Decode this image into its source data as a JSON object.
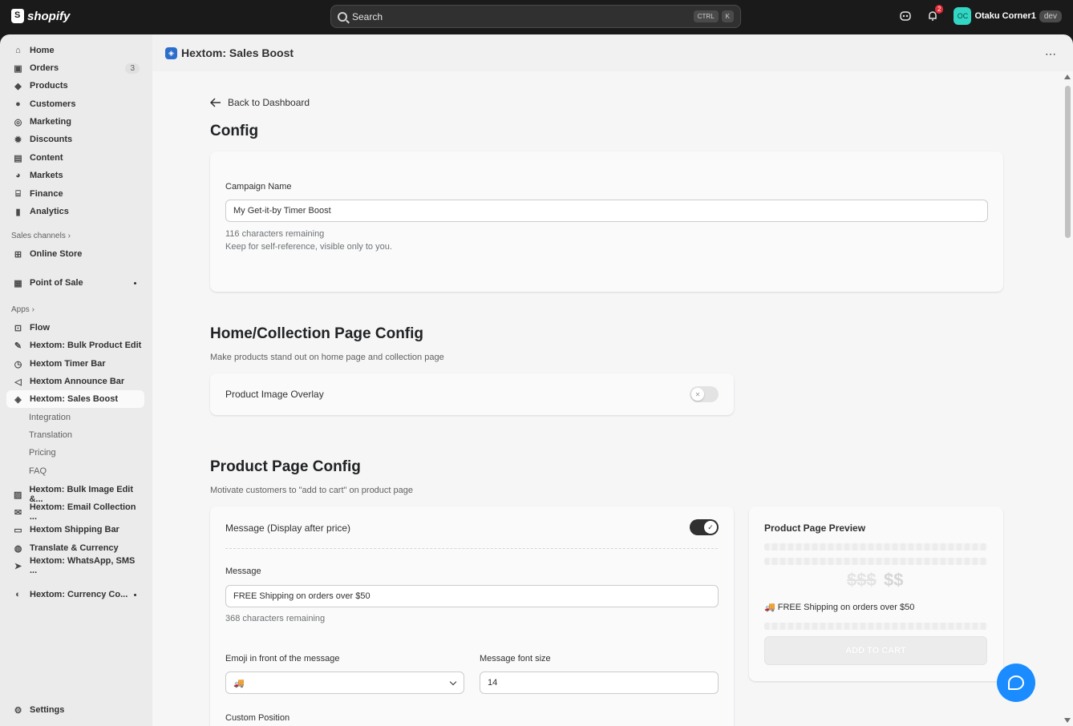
{
  "topbar": {
    "brand": "shopify",
    "search_placeholder": "Search",
    "kbd1": "CTRL",
    "kbd2": "K",
    "notification_count": "2",
    "avatar_initials": "OC",
    "store_name": "Otaku Corner1",
    "store_badge": "dev"
  },
  "sidebar": {
    "items": [
      {
        "label": "Home",
        "icon": "home-icon"
      },
      {
        "label": "Orders",
        "icon": "inbox-icon",
        "count": "3"
      },
      {
        "label": "Products",
        "icon": "tag-icon"
      },
      {
        "label": "Customers",
        "icon": "person-icon"
      },
      {
        "label": "Marketing",
        "icon": "target-icon"
      },
      {
        "label": "Discounts",
        "icon": "discount-icon"
      },
      {
        "label": "Content",
        "icon": "content-icon"
      },
      {
        "label": "Markets",
        "icon": "globe-icon"
      },
      {
        "label": "Finance",
        "icon": "bank-icon"
      },
      {
        "label": "Analytics",
        "icon": "chart-icon"
      }
    ],
    "sales_channels_label": "Sales channels",
    "online_store": "Online Store",
    "point_of_sale": "Point of Sale",
    "apps_label": "Apps",
    "apps": [
      "Flow",
      "Hextom: Bulk Product Edit",
      "Hextom Timer Bar",
      "Hextom Announce Bar",
      "Hextom: Sales Boost"
    ],
    "sub_items": [
      "Integration",
      "Translation",
      "Pricing",
      "FAQ"
    ],
    "more_apps": [
      "Hextom: Bulk Image Edit &...",
      "Hextom: Email Collection ...",
      "Hextom Shipping Bar",
      "Translate & Currency",
      "Hextom: WhatsApp, SMS ...",
      "Hextom: Currency Co..."
    ],
    "settings": "Settings"
  },
  "header": {
    "app_title": "Hextom: Sales Boost",
    "more": "⋯"
  },
  "page": {
    "back_label": "Back to Dashboard",
    "config_title": "Config",
    "campaign": {
      "label": "Campaign Name",
      "value": "My Get-it-by Timer Boost",
      "remaining": "116 characters remaining",
      "help": "Keep for self-reference, visible only to you."
    },
    "home_section": {
      "title": "Home/Collection Page Config",
      "subtitle": "Make products stand out on home page and collection page",
      "overlay_label": "Product Image Overlay",
      "overlay_enabled": false
    },
    "product_section": {
      "title": "Product Page Config",
      "subtitle": "Motivate customers to \"add to cart\" on product page",
      "message_toggle_label": "Message (Display after price)",
      "message_enabled": true,
      "message_label": "Message",
      "message_value": "FREE Shipping on orders over $50",
      "message_remaining": "368 characters remaining",
      "emoji_label": "Emoji in front of the message",
      "emoji_value": "🚚",
      "font_size_label": "Message font size",
      "font_size_value": "14",
      "custom_position_label": "Custom Position"
    },
    "preview": {
      "title": "Product Page Preview",
      "old_price": "$$$",
      "new_price": "$$",
      "emoji": "🚚",
      "message": "FREE Shipping on orders over $50",
      "add_to_cart": "ADD TO CART"
    }
  }
}
